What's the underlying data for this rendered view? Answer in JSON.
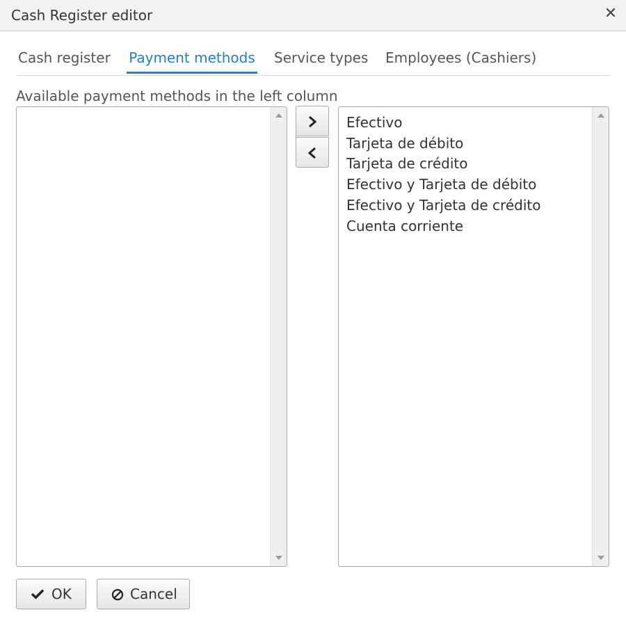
{
  "window": {
    "title": "Cash Register editor",
    "close_icon": "close-icon"
  },
  "tabs": [
    {
      "label": "Cash register",
      "active": false
    },
    {
      "label": "Payment methods",
      "active": true
    },
    {
      "label": "Service types",
      "active": false
    },
    {
      "label": "Employees (Cashiers)",
      "active": false
    }
  ],
  "hint": "Available payment methods in the left column",
  "available_list": {
    "items": []
  },
  "selected_list": {
    "items": [
      "Efectivo",
      "Tarjeta de débito",
      "Tarjeta de crédito",
      "Efectivo y Tarjeta de débito",
      "Efectivo y Tarjeta de crédito",
      "Cuenta corriente"
    ]
  },
  "move_buttons": {
    "add_icon": "chevron-right-icon",
    "remove_icon": "chevron-left-icon"
  },
  "footer": {
    "ok_label": "OK",
    "ok_icon": "checkmark-icon",
    "cancel_label": "Cancel",
    "cancel_icon": "cancel-circle-icon"
  },
  "colors": {
    "accent": "#1f7fd0",
    "text": "#333333",
    "titlebar_bg": "#f2f2f2",
    "scrollbar_bg": "#efefef"
  }
}
